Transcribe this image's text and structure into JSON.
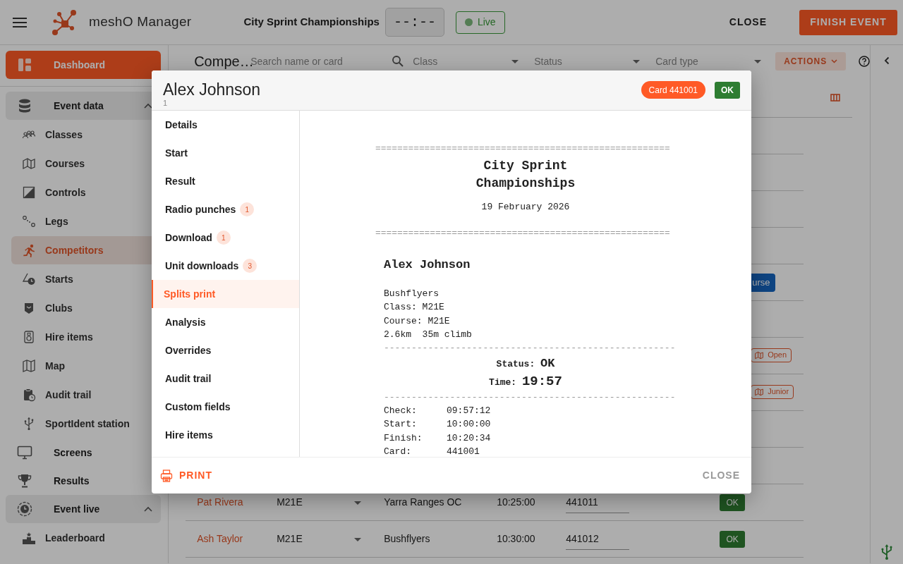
{
  "app_bar": {
    "app_name": "meshO Manager",
    "event_title": "City Sprint Championships",
    "clock": "--:--",
    "live_badge": "Live",
    "close_button": "CLOSE",
    "finish_button": "FINISH EVENT"
  },
  "sidebar": {
    "items": [
      {
        "kind": "top",
        "label": "Dashboard",
        "selected": true
      },
      {
        "kind": "group",
        "label": "Event data",
        "expanded": true,
        "children": [
          {
            "label": "Classes",
            "selected": false
          },
          {
            "label": "Courses",
            "selected": false
          },
          {
            "label": "Controls",
            "selected": false
          },
          {
            "label": "Legs",
            "selected": false
          },
          {
            "label": "Competitors",
            "selected": true
          },
          {
            "label": "Starts",
            "selected": false
          },
          {
            "label": "Clubs",
            "selected": false
          },
          {
            "label": "Hire items",
            "selected": false
          },
          {
            "label": "Map",
            "selected": false
          },
          {
            "label": "Audit trail",
            "selected": false
          },
          {
            "label": "SportIdent station",
            "selected": false
          }
        ]
      },
      {
        "kind": "top",
        "label": "Screens",
        "selected": false
      },
      {
        "kind": "top",
        "label": "Results",
        "selected": false
      },
      {
        "kind": "group",
        "label": "Event live",
        "expanded": true,
        "children": [
          {
            "label": "Leaderboard",
            "selected": false
          }
        ]
      }
    ]
  },
  "toolbar": {
    "title": "Compe…",
    "search_placeholder": "Search name or card",
    "filters": [
      {
        "placeholder": "Class"
      },
      {
        "placeholder": "Status"
      },
      {
        "placeholder": "Card type"
      }
    ],
    "actions_button": "ACTIONS"
  },
  "table": {
    "rows": [
      {
        "kind": "covered"
      },
      {
        "kind": "covered"
      },
      {
        "kind": "covered"
      },
      {
        "kind": "covered"
      },
      {
        "kind": "partial",
        "extra": {
          "kind": "button",
          "label": "urse"
        }
      },
      {
        "kind": "covered"
      },
      {
        "kind": "partial",
        "extra": {
          "kind": "tag",
          "label": "Open"
        }
      },
      {
        "kind": "partial",
        "extra": {
          "kind": "tag",
          "label": "Junior"
        }
      },
      {
        "kind": "covered"
      },
      {
        "kind": "covered"
      },
      {
        "kind": "full",
        "name": "Pat Rivera",
        "class": "M21E",
        "club": "Yarra Ranges OC",
        "start": "10:25:00",
        "card": "441011",
        "status": "OK"
      },
      {
        "kind": "full",
        "name": "Ash Taylor",
        "class": "M21E",
        "club": "Bushflyers",
        "start": "10:30:00",
        "card": "441012",
        "status": "OK"
      }
    ]
  },
  "dialog": {
    "title": "Alex Johnson",
    "subtitle": "1",
    "card_badge": "Card 441001",
    "status_badge": "OK",
    "nav": [
      {
        "label": "Details",
        "selected": false
      },
      {
        "label": "Start",
        "selected": false
      },
      {
        "label": "Result",
        "selected": false
      },
      {
        "label": "Radio punches",
        "count": "1",
        "selected": false
      },
      {
        "label": "Download",
        "count": "1",
        "selected": false
      },
      {
        "label": "Unit downloads",
        "count": "3",
        "selected": false
      },
      {
        "label": "Splits print",
        "selected": true
      },
      {
        "label": "Analysis",
        "selected": false
      },
      {
        "label": "Overrides",
        "selected": false
      },
      {
        "label": "Audit trail",
        "selected": false
      },
      {
        "label": "Custom fields",
        "selected": false
      },
      {
        "label": "Hire items",
        "selected": false
      }
    ],
    "receipt": [
      {
        "kind": "rule",
        "text": "======================================================"
      },
      {
        "kind": "title",
        "text": "City Sprint Championships"
      },
      {
        "kind": "date",
        "text": "19 February 2026"
      },
      {
        "kind": "rule",
        "text": "======================================================"
      },
      {
        "kind": "name",
        "text": "Alex Johnson"
      },
      {
        "kind": "info",
        "text": "Bushflyers"
      },
      {
        "kind": "info",
        "text": "Class: M21E"
      },
      {
        "kind": "info",
        "text": "Course: M21E"
      },
      {
        "kind": "info",
        "text": "2.6km  35m climb"
      },
      {
        "kind": "dash",
        "text": "-----------------------------------------------------"
      },
      {
        "kind": "status",
        "label": "Status:",
        "value": "OK"
      },
      {
        "kind": "total",
        "label": "Time:",
        "value": "19:57"
      },
      {
        "kind": "dash",
        "text": "-----------------------------------------------------"
      },
      {
        "kind": "pair",
        "label": "Check:",
        "value": "09:57:12"
      },
      {
        "kind": "pair",
        "label": "Start:",
        "value": "10:00:00"
      },
      {
        "kind": "pair",
        "label": "Finish:",
        "value": "10:20:34"
      },
      {
        "kind": "pair",
        "label": "Card:",
        "value": "441001"
      }
    ],
    "print_button": "PRINT",
    "close_button": "CLOSE"
  }
}
